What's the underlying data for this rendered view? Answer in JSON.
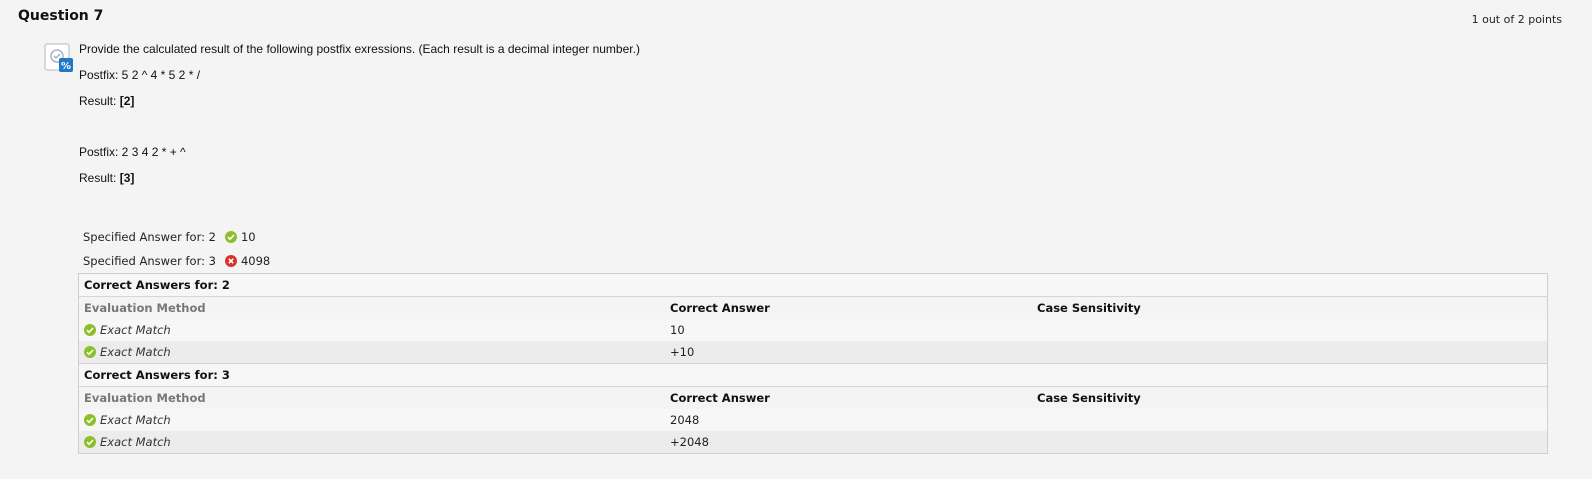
{
  "question": {
    "title": "Question 7",
    "points": "1 out of 2 points",
    "prompt": "Provide the calculated result of the following postfix exressions. (Each result is a decimal integer number.)",
    "blocks": [
      {
        "postfix_label": "Postfix: 5 2 ^ 4 * 5 2 * /",
        "result_label": "Result:",
        "result_var": "[2]"
      },
      {
        "postfix_label": "Postfix: 2 3 4 2 * + ^",
        "result_label": "Result:",
        "result_var": "[3]"
      }
    ],
    "icon": "calculated-question-icon"
  },
  "specified": [
    {
      "label": "Specified Answer for: 2",
      "status": "correct",
      "status_icon": "check-circle-icon",
      "value": "10"
    },
    {
      "label": "Specified Answer for: 3",
      "status": "incorrect",
      "status_icon": "x-circle-icon",
      "value": "4098"
    }
  ],
  "correct_answers": [
    {
      "header": "Correct Answers for: 2",
      "columns": [
        "Evaluation Method",
        "Correct Answer",
        "Case Sensitivity"
      ],
      "rows": [
        {
          "method": "Exact Match",
          "answer": "10",
          "case": ""
        },
        {
          "method": "Exact Match",
          "answer": "+10",
          "case": ""
        }
      ]
    },
    {
      "header": "Correct Answers for: 3",
      "columns": [
        "Evaluation Method",
        "Correct Answer",
        "Case Sensitivity"
      ],
      "rows": [
        {
          "method": "Exact Match",
          "answer": "2048",
          "case": ""
        },
        {
          "method": "Exact Match",
          "answer": "+2048",
          "case": ""
        }
      ]
    }
  ],
  "colors": {
    "correct": "#8dbf2b",
    "incorrect": "#d9312b",
    "background": "#f4f4f4",
    "border": "#cfcfcf"
  }
}
